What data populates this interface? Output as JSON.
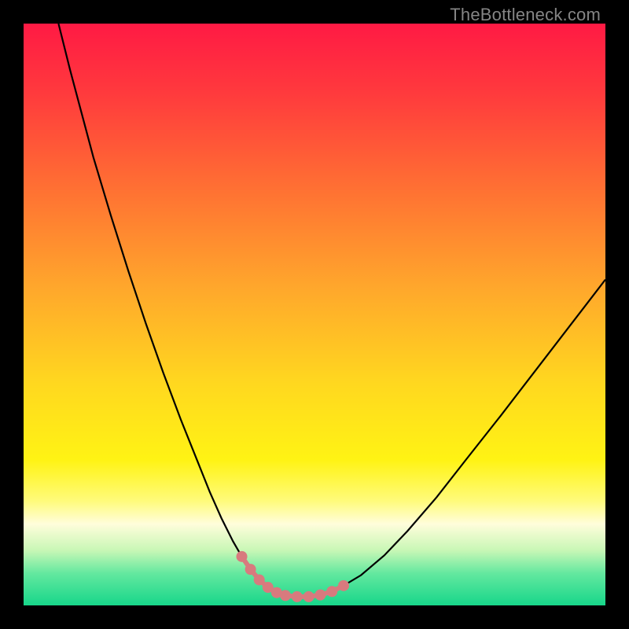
{
  "watermark": "TheBottleneck.com",
  "chart_data": {
    "type": "line",
    "title": "",
    "xlabel": "",
    "ylabel": "",
    "xlim": [
      0,
      100
    ],
    "ylim": [
      0,
      100
    ],
    "grid": false,
    "legend": false,
    "background_gradient": {
      "stops": [
        {
          "offset": 0.0,
          "color": "#ff1a44"
        },
        {
          "offset": 0.12,
          "color": "#ff3a3d"
        },
        {
          "offset": 0.28,
          "color": "#ff6f33"
        },
        {
          "offset": 0.45,
          "color": "#ffa62c"
        },
        {
          "offset": 0.62,
          "color": "#ffd81f"
        },
        {
          "offset": 0.75,
          "color": "#fff314"
        },
        {
          "offset": 0.82,
          "color": "#fffb7a"
        },
        {
          "offset": 0.86,
          "color": "#fffddb"
        },
        {
          "offset": 0.905,
          "color": "#c9f7b6"
        },
        {
          "offset": 0.945,
          "color": "#63e89f"
        },
        {
          "offset": 1.0,
          "color": "#17d68a"
        }
      ]
    },
    "series": [
      {
        "name": "bottleneck-curve",
        "stroke": "#000000",
        "stroke_width": 2.2,
        "x": [
          6,
          8,
          10,
          12,
          15,
          18,
          21,
          24,
          27,
          30,
          32,
          34,
          36,
          37.5,
          39,
          40.5,
          42,
          43.5,
          45,
          47,
          49,
          51,
          53,
          55,
          58,
          62,
          66,
          71,
          76,
          82,
          88,
          94,
          100
        ],
        "y": [
          100,
          92,
          84.5,
          77,
          67,
          57.5,
          48.5,
          40,
          32,
          24.5,
          19.5,
          15,
          11,
          8.4,
          6.2,
          4.4,
          3.1,
          2.2,
          1.7,
          1.5,
          1.5,
          1.8,
          2.4,
          3.4,
          5.2,
          8.6,
          12.8,
          18.6,
          25,
          32.6,
          40.4,
          48.2,
          56
        ]
      },
      {
        "name": "bottom-markers",
        "stroke": "#d87a7e",
        "marker_color": "#d87a7e",
        "marker_radius": 7,
        "stroke_width": 6,
        "x": [
          37.5,
          39,
          40.5,
          42,
          43.5,
          45,
          47,
          49,
          51,
          53,
          55
        ],
        "y": [
          8.4,
          6.2,
          4.4,
          3.1,
          2.2,
          1.7,
          1.5,
          1.5,
          1.8,
          2.4,
          3.4
        ]
      }
    ]
  }
}
